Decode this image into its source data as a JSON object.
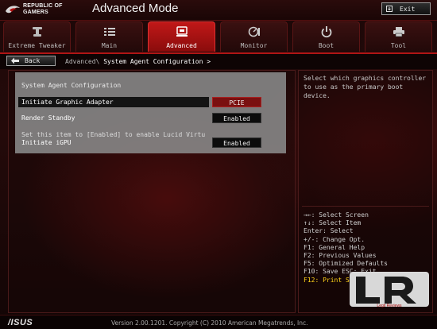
{
  "brand": {
    "line1": "REPUBLIC OF",
    "line2": "GAMERS"
  },
  "header": {
    "title": "Advanced Mode",
    "exit_label": "Exit"
  },
  "tabs": [
    {
      "label": "Extreme Tweaker",
      "icon": "wrench-icon",
      "active": false
    },
    {
      "label": "Main",
      "icon": "list-icon",
      "active": false
    },
    {
      "label": "Advanced",
      "icon": "chip-icon",
      "active": true
    },
    {
      "label": "Monitor",
      "icon": "gauge-icon",
      "active": false
    },
    {
      "label": "Boot",
      "icon": "power-icon",
      "active": false
    },
    {
      "label": "Tool",
      "icon": "printer-icon",
      "active": false
    }
  ],
  "nav": {
    "back_label": "Back",
    "breadcrumb_parent": "Advanced\\",
    "breadcrumb_current": "System Agent Configuration >"
  },
  "main": {
    "section_title": "System Agent Configuration",
    "items": [
      {
        "label": "Initiate Graphic Adapter",
        "value": "PCIE"
      },
      {
        "label": "Render Standby",
        "value": "Enabled"
      },
      {
        "hint": "Set this item to [Enabled] to enable Lucid Virtu",
        "label": "Initiate iGPU",
        "value": "Enabled"
      }
    ]
  },
  "help": {
    "description": "Select which graphics controller to use as the primary boot device.",
    "keys": [
      "→←: Select Screen",
      "↑↓: Select Item",
      "Enter: Select",
      "+/-: Change Opt.",
      "F1: General Help",
      "F2: Previous Values",
      "F5: Optimized Defaults",
      "F10: Save  ESC: Exit"
    ],
    "highlight_key": "F12: Print Sc"
  },
  "watermark": {
    "line1": "Legit",
    "line2": "Reviews"
  },
  "footer": {
    "brand": "/ISUS",
    "version": "Version 2.00.1201. Copyright (C) 2010 American Megatrends, Inc."
  }
}
